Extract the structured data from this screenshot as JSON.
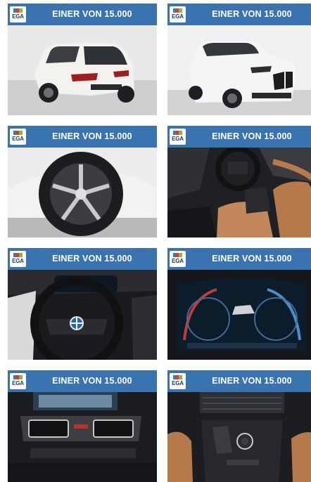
{
  "gallery": {
    "tiles": [
      {
        "logo_text": "EGA",
        "title": "EINER VON 15.000",
        "photo": "car-rear-three-quarter-photo"
      },
      {
        "logo_text": "EGA",
        "title": "EINER VON 15.000",
        "photo": "car-front-three-quarter-photo"
      },
      {
        "logo_text": "EGA",
        "title": "EINER VON 15.000",
        "photo": "alloy-wheel-photo"
      },
      {
        "logo_text": "EGA",
        "title": "EINER VON 15.000",
        "photo": "interior-seats-photo"
      },
      {
        "logo_text": "EGA",
        "title": "EINER VON 15.000",
        "photo": "steering-wheel-photo"
      },
      {
        "logo_text": "EGA",
        "title": "EINER VON 15.000",
        "photo": "digital-cluster-photo"
      },
      {
        "logo_text": "EGA",
        "title": "EINER VON 15.000",
        "photo": "dashboard-vents-photo"
      },
      {
        "logo_text": "EGA",
        "title": "EINER VON 15.000",
        "photo": "center-console-photo"
      }
    ]
  },
  "colors": {
    "banner": "#3a74b0",
    "banner_text": "#ffffff"
  }
}
